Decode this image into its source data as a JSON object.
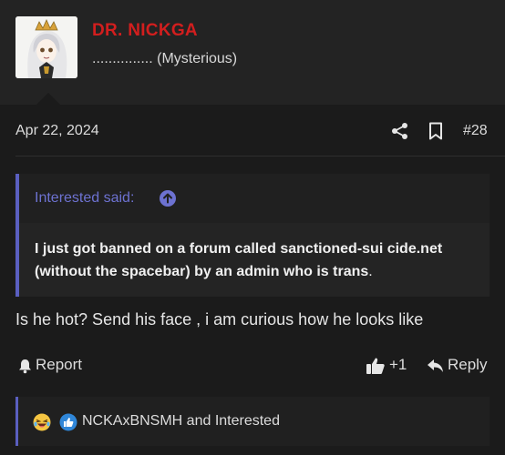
{
  "post": {
    "author": {
      "username": "DR. NICKGA",
      "user_title": "............... (Mysterious)",
      "username_color": "#d21e1e"
    },
    "date": "Apr 22, 2024",
    "post_number": "#28",
    "icons": {
      "share": "share-icon",
      "bookmark": "bookmark-icon"
    },
    "quote": {
      "author_said": "Interested said:",
      "jump_icon": "arrow-up-circle-icon",
      "body": "I just got banned on a forum called sanctioned-sui cide.net (without the spacebar) by an admin who is trans",
      "body_end": ".",
      "accent_color": "#5a5fc0"
    },
    "body": "Is he hot? Send his face , i am curious how he looks like",
    "actions": {
      "report_label": "Report",
      "like_label": "+1",
      "reply_label": "Reply"
    },
    "reactions": {
      "icons": [
        "laughing-emoji-icon",
        "thumbs-up-icon"
      ],
      "text": "NCKAxBNSMH and Interested"
    }
  }
}
